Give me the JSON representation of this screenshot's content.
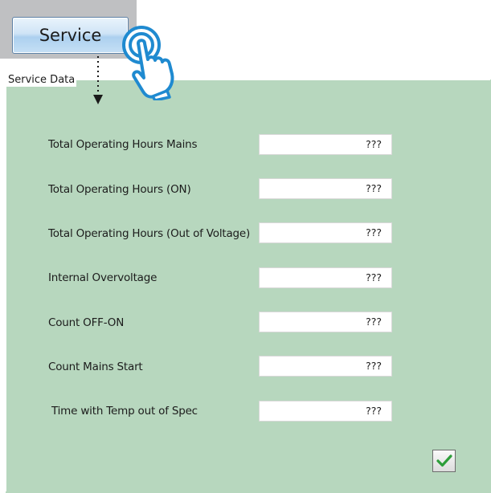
{
  "header": {
    "service_button_label": "Service"
  },
  "panel": {
    "legend": "Service Data",
    "fields": [
      {
        "label": "Total Operating Hours Mains",
        "value": "???"
      },
      {
        "label": "Total Operating Hours (ON)",
        "value": "???"
      },
      {
        "label": "Total Operating Hours (Out of Voltage)",
        "value": "???"
      },
      {
        "label": "Internal Overvoltage",
        "value": "???"
      },
      {
        "label": "Count OFF-ON",
        "value": "???"
      },
      {
        "label": "Count Mains Start",
        "value": "???"
      },
      {
        "label": "Time with Temp out of Spec",
        "value": "???"
      }
    ]
  },
  "icons": {
    "confirm": "checkmark-icon",
    "pointer": "tap-hand-icon",
    "arrow": "dotted-down-arrow-icon"
  },
  "colors": {
    "panel_bg": "#b7d7be",
    "header_bg": "#bfc0c2",
    "button_accent": "#acd0ef",
    "check_green": "#2e9e3a",
    "hand_blue": "#1f8ad0"
  }
}
